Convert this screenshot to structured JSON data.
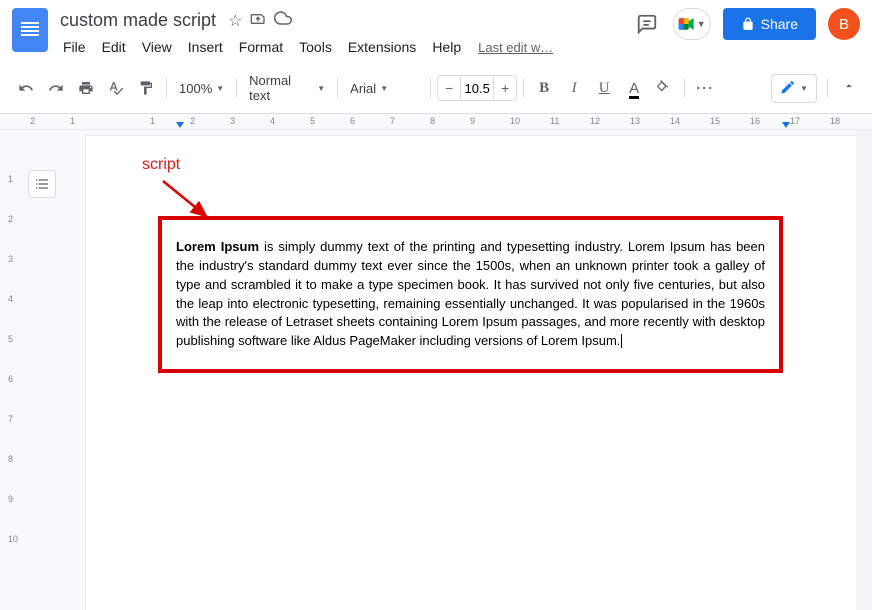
{
  "header": {
    "doc_title": "custom made script",
    "last_edit": "Last edit w…",
    "share_label": "Share",
    "avatar_letter": "B"
  },
  "menubar": {
    "items": [
      "File",
      "Edit",
      "View",
      "Insert",
      "Format",
      "Tools",
      "Extensions",
      "Help"
    ]
  },
  "toolbar": {
    "zoom": "100%",
    "style": "Normal text",
    "font": "Arial",
    "font_size": "10.5"
  },
  "ruler": {
    "ticks": [
      "2",
      "1",
      "",
      "1",
      "2",
      "3",
      "4",
      "5",
      "6",
      "7",
      "8",
      "9",
      "10",
      "11",
      "12",
      "13",
      "14",
      "15",
      "16",
      "17",
      "18"
    ]
  },
  "vruler": {
    "ticks": [
      "",
      "1",
      "2",
      "3",
      "4",
      "5",
      "6",
      "7",
      "8",
      "9",
      "10"
    ]
  },
  "annotation": {
    "label": "script"
  },
  "content": {
    "bold_lead": "Lorem Ipsum",
    "body": " is simply dummy text of the printing and typesetting industry. Lorem Ipsum has been the industry's standard dummy text ever since the 1500s, when an unknown printer took a galley of type and scrambled it to make a type specimen book. It has survived not only five centuries, but also the leap into electronic typesetting, remaining essentially unchanged. It was popularised in the 1960s with the release of Letraset sheets containing Lorem Ipsum passages, and more recently with desktop publishing software like Aldus PageMaker including versions of Lorem Ipsum."
  }
}
